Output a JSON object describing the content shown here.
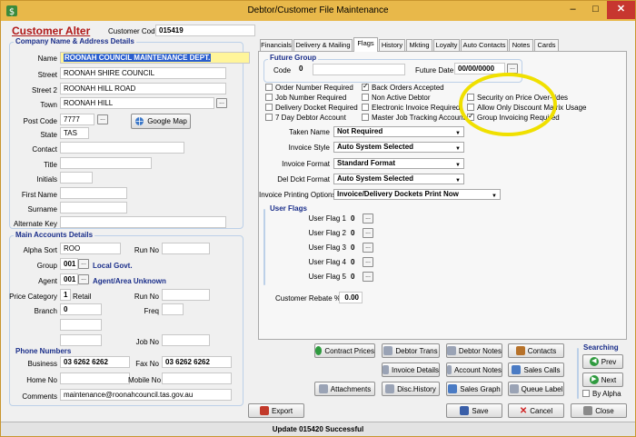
{
  "window": {
    "title": "Debtor/Customer File Maintenance",
    "min": "–",
    "max": "□",
    "close": "✕"
  },
  "header": {
    "heading": "Customer Alter",
    "code_label": "Customer Code",
    "code_value": "015419"
  },
  "company": {
    "title": "Company Name & Address Details",
    "name_label": "Name",
    "name_value": "ROONAH COUNCIL MAINTENANCE DEPT.",
    "street_label": "Street",
    "street_value": "ROONAH SHIRE COUNCIL",
    "street2_label": "Street 2",
    "street2_value": "ROONAH HILL ROAD",
    "town_label": "Town",
    "town_value": "ROONAH HILL",
    "postcode_label": "Post Code",
    "postcode_value": "7777",
    "google_map_label": "Google Map",
    "state_label": "State",
    "state_value": "TAS",
    "contact_label": "Contact",
    "title_label": "Title",
    "initials_label": "Initials",
    "firstname_label": "First Name",
    "surname_label": "Surname",
    "altkey_label": "Alternate Key"
  },
  "accounts": {
    "title": "Main Accounts Details",
    "alpha_label": "Alpha Sort",
    "alpha_value": "ROO",
    "runno_label": "Run No",
    "group_label": "Group",
    "group_value": "001",
    "group_desc": "Local Govt.",
    "agent_label": "Agent",
    "agent_value": "001",
    "agent_desc": "Agent/Area Unknown",
    "pricecat_label": "Price Category",
    "pricecat_value": "1",
    "pricecat_desc": "Retail",
    "runno2_label": "Run No",
    "branch_label": "Branch",
    "branch_value": "0",
    "freq_label": "Freq",
    "jobno_label": "Job No"
  },
  "phone": {
    "title": "Phone Numbers",
    "business_label": "Business",
    "business_value": "03 6262 6262",
    "fax_label": "Fax No",
    "fax_value": "03 6262 6262",
    "home_label": "Home No",
    "mobile_label": "Mobile No",
    "comments_label": "Comments",
    "comments_value": "maintenance@roonahcouncil.tas.gov.au"
  },
  "tabs": [
    "Financials",
    "Delivery & Mailing",
    "Flags",
    "History",
    "Mkting",
    "Loyalty",
    "Auto Contacts",
    "Notes",
    "Cards"
  ],
  "future": {
    "title": "Future Group",
    "code_label": "Code",
    "code_value": "0",
    "date_label": "Future Date",
    "date_value": "00/00/0000"
  },
  "flags": {
    "col1": [
      "Order Number Required",
      "Job Number Required",
      "Delivery Docket Required",
      "7 Day Debtor Account"
    ],
    "col2": [
      "Back Orders Accepted",
      "Non Active Debtor",
      "Electronic Invoice Required",
      "Master Job Tracking Account"
    ],
    "col3": [
      "Security on Price Over-rides",
      "Allow Only Discount Matrix Usage",
      "Group Invoicing Required"
    ]
  },
  "dropdowns": [
    {
      "label": "Taken Name",
      "value": "Not Required"
    },
    {
      "label": "Invoice Style",
      "value": "Auto System Selected"
    },
    {
      "label": "Invoice Format",
      "value": "Standard Format"
    },
    {
      "label": "Del Dckt Format",
      "value": "Auto System Selected"
    },
    {
      "label": "Invoice Printing Options",
      "value": "Invoice/Delivery Dockets Print Now"
    }
  ],
  "user_flags": {
    "title": "User Flags",
    "items": [
      {
        "label": "User Flag 1",
        "value": "0"
      },
      {
        "label": "User Flag 2",
        "value": "0"
      },
      {
        "label": "User Flag 3",
        "value": "0"
      },
      {
        "label": "User Flag 4",
        "value": "0"
      },
      {
        "label": "User Flag 5",
        "value": "0"
      }
    ]
  },
  "rebate": {
    "label": "Customer Rebate %",
    "value": "0.00"
  },
  "buttons": {
    "contract_prices": "Contract Prices",
    "debtor_trans": "Debtor Trans",
    "debtor_notes": "Debtor Notes",
    "contacts": "Contacts",
    "invoice_details": "Invoice Details",
    "account_notes": "Account Notes",
    "sales_calls": "Sales Calls",
    "attachments": "Attachments",
    "disc_history": "Disc.History",
    "sales_graph": "Sales Graph",
    "queue_label": "Queue Label",
    "export": "Export",
    "save": "Save",
    "cancel": "Cancel",
    "close": "Close"
  },
  "searching": {
    "title": "Searching",
    "prev": "Prev",
    "next": "Next",
    "by_alpha": "By Alpha"
  },
  "status": "Update 015420 Successful"
}
